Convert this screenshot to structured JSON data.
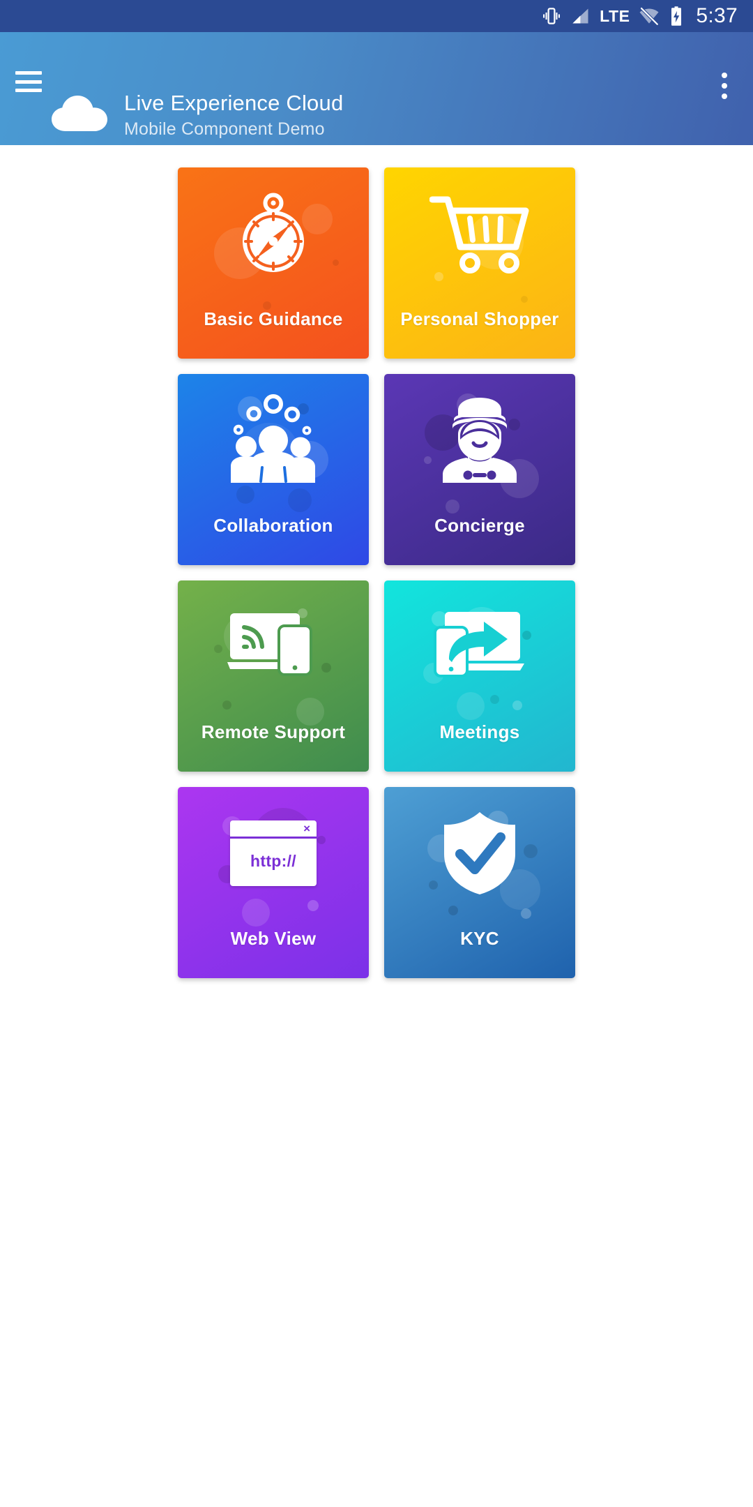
{
  "status_bar": {
    "time": "5:37",
    "icons": [
      {
        "name": "vibrate-icon"
      },
      {
        "name": "signal-bars-icon"
      },
      {
        "name": "lte-label-icon",
        "label": "LTE"
      },
      {
        "name": "wifi-off-icon"
      },
      {
        "name": "battery-charging-icon"
      }
    ],
    "background_color": "#2b4a93"
  },
  "app_bar": {
    "menu_icon": "hamburger-menu-icon",
    "overflow_icon": "overflow-menu-icon",
    "logo_icon": "cloud-logo-icon",
    "title": "Live Experience Cloud",
    "subtitle": "Mobile Component Demo",
    "gradient_start": "#4a9bd4",
    "gradient_end": "#4061ad"
  },
  "grid": {
    "tiles": [
      {
        "id": "basic-guidance",
        "label": "Basic Guidance",
        "icon": "compass-icon",
        "color_start": "#f97316",
        "color_end": "#f4511e"
      },
      {
        "id": "personal-shopper",
        "label": "Personal Shopper",
        "icon": "shopping-cart-icon",
        "color_start": "#ffd500",
        "color_end": "#fcb316"
      },
      {
        "id": "collaboration",
        "label": "Collaboration",
        "icon": "people-group-icon",
        "color_start": "#1d84e8",
        "color_end": "#2f48e6"
      },
      {
        "id": "concierge",
        "label": "Concierge",
        "icon": "bellhop-person-icon",
        "color_start": "#5b37b5",
        "color_end": "#3b2a86"
      },
      {
        "id": "remote-support",
        "label": "Remote Support",
        "icon": "laptop-phone-cast-icon",
        "color_start": "#74b14a",
        "color_end": "#3f8c4e"
      },
      {
        "id": "meetings",
        "label": "Meetings",
        "icon": "screen-share-arrow-icon",
        "color_start": "#12e5dd",
        "color_end": "#22b6cf"
      },
      {
        "id": "web-view",
        "label": "Web View",
        "icon": "browser-window-icon",
        "browser_url_text": "http://",
        "browser_close_glyph": "×",
        "color_start": "#ac36f0",
        "color_end": "#7b31e8"
      },
      {
        "id": "kyc",
        "label": "KYC",
        "icon": "shield-check-icon",
        "color_start": "#4e9fd4",
        "color_end": "#1f62ad"
      }
    ]
  }
}
